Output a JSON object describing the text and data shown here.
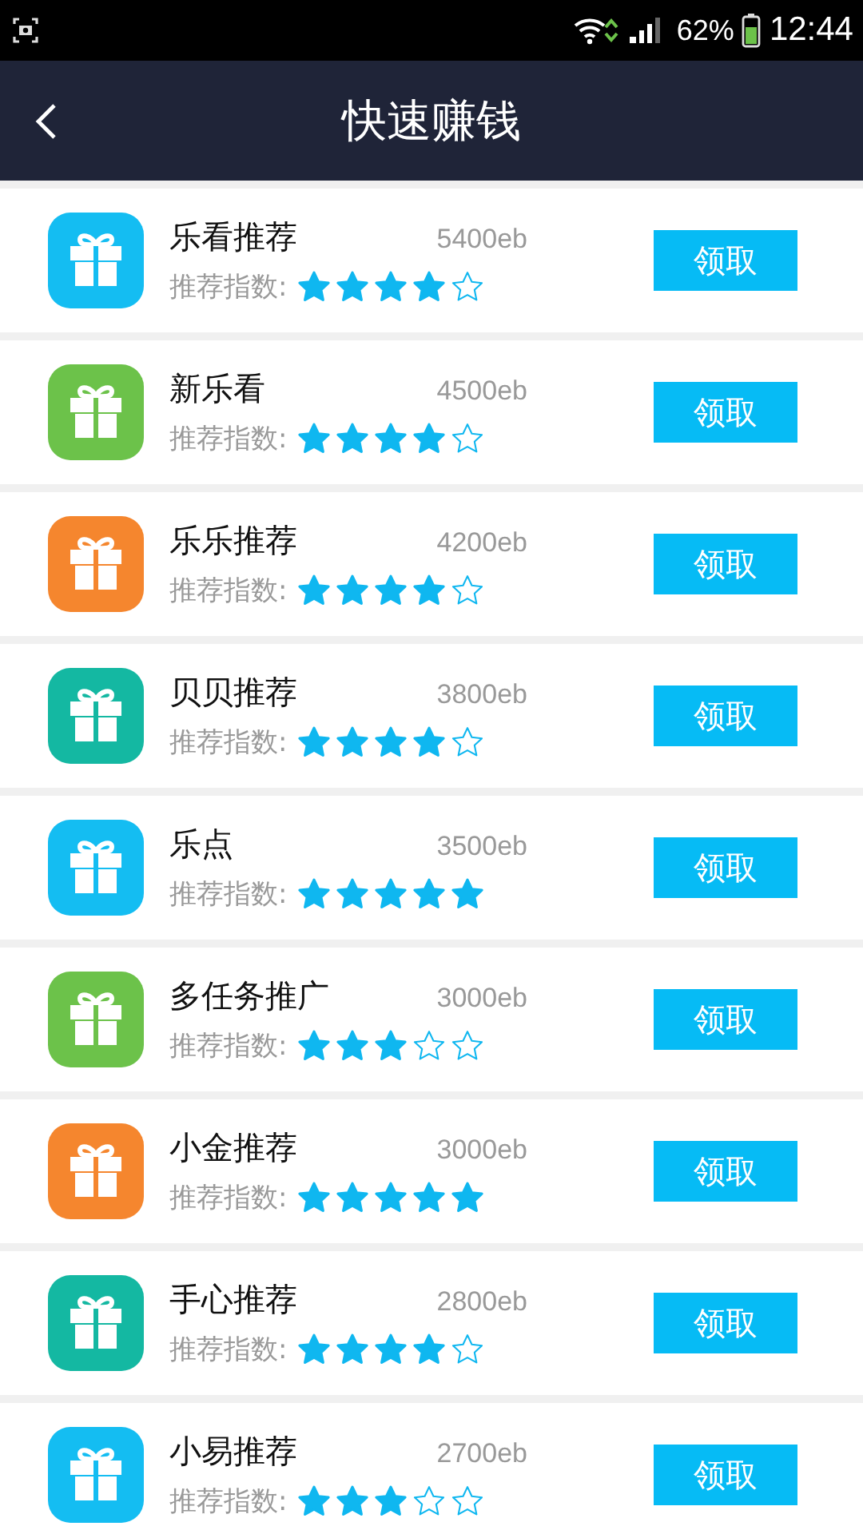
{
  "status_bar": {
    "battery": "62%",
    "time": "12:44"
  },
  "header": {
    "title": "快速赚钱"
  },
  "items": [
    {
      "name": "乐看推荐",
      "reward": "5400eb",
      "label": "推荐指数:",
      "stars": 4,
      "color": "#14bdf2",
      "button": "领取"
    },
    {
      "name": "新乐看",
      "reward": "4500eb",
      "label": "推荐指数:",
      "stars": 4,
      "color": "#6cc24a",
      "button": "领取"
    },
    {
      "name": "乐乐推荐",
      "reward": "4200eb",
      "label": "推荐指数:",
      "stars": 4,
      "color": "#f5862e",
      "button": "领取"
    },
    {
      "name": "贝贝推荐",
      "reward": "3800eb",
      "label": "推荐指数:",
      "stars": 4,
      "color": "#14b8a2",
      "button": "领取"
    },
    {
      "name": "乐点",
      "reward": "3500eb",
      "label": "推荐指数:",
      "stars": 5,
      "color": "#14bdf2",
      "button": "领取"
    },
    {
      "name": "多任务推广",
      "reward": "3000eb",
      "label": "推荐指数:",
      "stars": 3,
      "color": "#6cc24a",
      "button": "领取"
    },
    {
      "name": "小金推荐",
      "reward": "3000eb",
      "label": "推荐指数:",
      "stars": 5,
      "color": "#f5862e",
      "button": "领取"
    },
    {
      "name": "手心推荐",
      "reward": "2800eb",
      "label": "推荐指数:",
      "stars": 4,
      "color": "#14b8a2",
      "button": "领取"
    },
    {
      "name": "小易推荐",
      "reward": "2700eb",
      "label": "推荐指数:",
      "stars": 3,
      "color": "#14bdf2",
      "button": "领取"
    }
  ]
}
